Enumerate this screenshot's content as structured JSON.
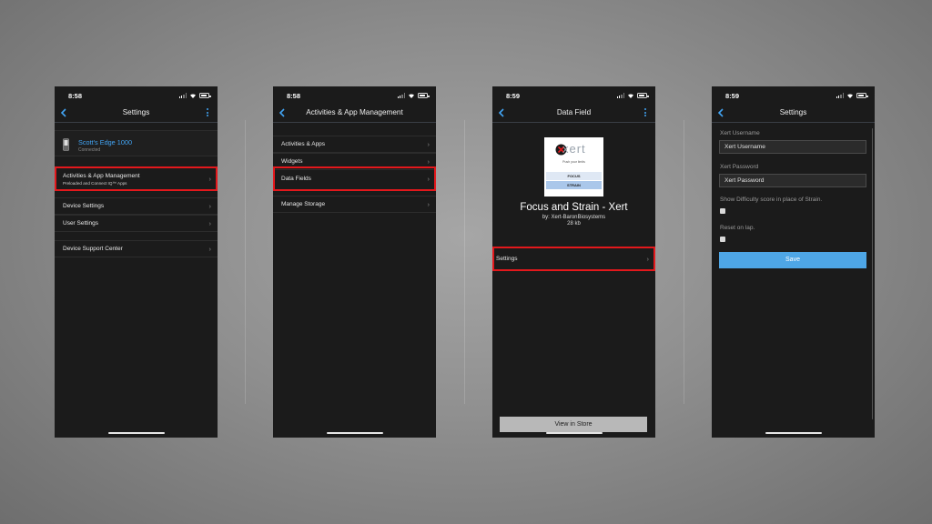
{
  "phones": [
    {
      "time": "8:58",
      "title": "Settings",
      "device": {
        "name": "Scott's Edge 1000",
        "status": "Connected"
      },
      "rows": [
        {
          "label": "Activities & App Management",
          "sublabel": "Preloaded and Connect IQ™ Apps",
          "highlighted": true
        },
        {
          "label": "Device Settings"
        },
        {
          "label": "User Settings"
        },
        {
          "label": "Device Support Center"
        }
      ]
    },
    {
      "time": "8:58",
      "title": "Activities & App Management",
      "rows": [
        {
          "label": "Activities & Apps"
        },
        {
          "label": "Widgets"
        },
        {
          "label": "Data Fields",
          "highlighted": true
        },
        {
          "label": "Manage Storage"
        }
      ]
    },
    {
      "time": "8:59",
      "title": "Data Field",
      "app": {
        "logo_text": "xert",
        "tagline": "Push your limits",
        "badge_top": "FOCUS",
        "badge_bottom": "STRAIN",
        "name": "Focus and Strain - Xert",
        "developer": "by: Xert-BaronBiosystems",
        "size": "28 kb"
      },
      "settings_row": {
        "label": "Settings",
        "highlighted": true
      },
      "store_button": "View in Store"
    },
    {
      "time": "8:59",
      "title": "Settings",
      "fields": [
        {
          "label": "Xert Username",
          "value": "Xert Username"
        },
        {
          "label": "Xert Password",
          "value": "Xert Password"
        }
      ],
      "checkboxes": [
        {
          "label": "Show Difficulty score in place of Strain.",
          "checked": false
        },
        {
          "label": "Reset on lap.",
          "checked": false
        }
      ],
      "save_button": "Save"
    }
  ],
  "colors": {
    "accent": "#42a5f5",
    "highlight": "#e3181c",
    "save": "#4ea6e6",
    "screen_bg": "#1b1b1b"
  }
}
